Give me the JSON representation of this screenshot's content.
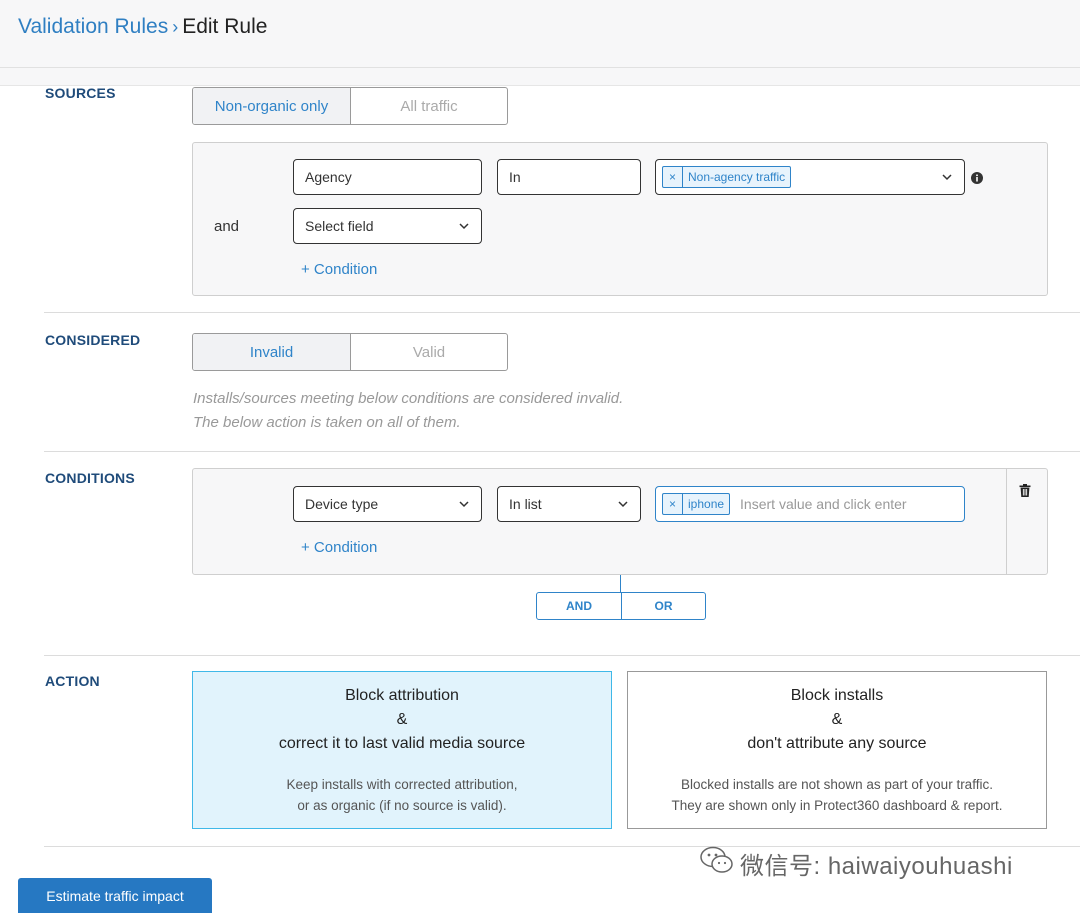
{
  "breadcrumb": {
    "parent": "Validation Rules",
    "separator": "›",
    "current": "Edit Rule"
  },
  "sources": {
    "label": "SOURCES",
    "toggle": [
      "Non-organic only",
      "All traffic"
    ],
    "row1": {
      "field": "Agency",
      "operator": "In",
      "tag": "Non-agency traffic"
    },
    "and_label": "and",
    "row2": {
      "field_placeholder": "Select field"
    },
    "add_condition": "+ Condition"
  },
  "considered": {
    "label": "CONSIDERED",
    "toggle": [
      "Invalid",
      "Valid"
    ],
    "note_line1": "Installs/sources meeting below conditions are considered invalid.",
    "note_line2": "The below action is taken on all of them."
  },
  "conditions": {
    "label": "CONDITIONS",
    "field": "Device type",
    "operator": "In list",
    "tag": "iphone",
    "value_placeholder": "Insert value and click enter",
    "add_condition": "+ Condition",
    "and_label": "AND",
    "or_label": "OR"
  },
  "action": {
    "label": "ACTION",
    "cards": [
      {
        "title1": "Block attribution",
        "title2": "&",
        "title3": "correct it to last valid media source",
        "desc1": "Keep installs with corrected attribution,",
        "desc2": "or as organic (if no source is valid)."
      },
      {
        "title1": "Block installs",
        "title2": "&",
        "title3": "don't attribute any source",
        "desc1": "Blocked installs are not shown as part of your traffic.",
        "desc2": "They are shown only in Protect360 dashboard & report."
      }
    ]
  },
  "footer": {
    "estimate_button": "Estimate traffic impact"
  },
  "watermark": "微信号: haiwaiyouhuashi",
  "colors": {
    "accent": "#2f84c9",
    "primary_button": "#2678c2",
    "selected_card_bg": "#e1f3fc",
    "selected_card_border": "#3fb8e8",
    "section_label": "#1f4b7a"
  }
}
